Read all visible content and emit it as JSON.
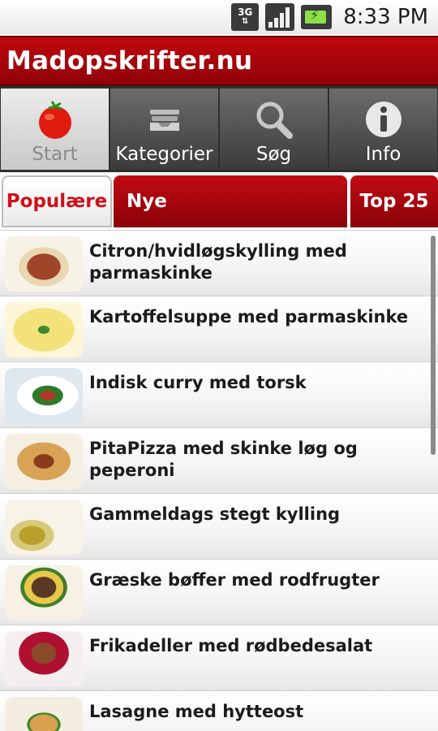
{
  "status_bar": {
    "network": "3G",
    "time": "8:33 PM"
  },
  "app": {
    "title": "Madopskrifter.nu"
  },
  "main_tabs": [
    {
      "label": "Start",
      "icon": "tomato-icon",
      "active": true
    },
    {
      "label": "Kategorier",
      "icon": "category-tray-icon",
      "active": false
    },
    {
      "label": "Søg",
      "icon": "search-icon",
      "active": false
    },
    {
      "label": "Info",
      "icon": "info-icon",
      "active": false
    }
  ],
  "sub_tabs": [
    {
      "label": "Populære",
      "active": true
    },
    {
      "label": "Nye",
      "active": false
    },
    {
      "label": "Top 25",
      "active": false
    }
  ],
  "recipes": [
    {
      "title": "Citron/hvidløgskylling med parmaskinke"
    },
    {
      "title": "Kartoffelsuppe med parmaskinke"
    },
    {
      "title": "Indisk curry med torsk"
    },
    {
      "title": "PitaPizza med skinke løg og peperoni"
    },
    {
      "title": "Gammeldags stegt kylling"
    },
    {
      "title": "Græske bøffer med rodfrugter"
    },
    {
      "title": "Frikadeller med rødbedesalat"
    },
    {
      "title": "Lasagne med hytteost"
    }
  ],
  "colors": {
    "brand_red": "#b0060d",
    "tab_active_text": "#d0101a"
  }
}
